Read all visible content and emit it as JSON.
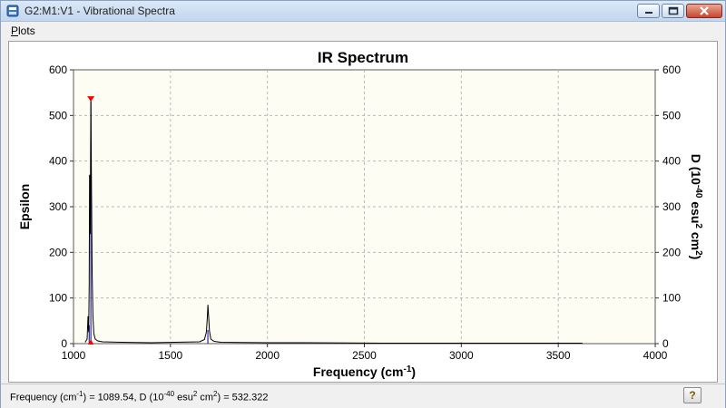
{
  "window": {
    "title": "G2:M1:V1 - Vibrational Spectra",
    "icons": [
      "app-icon",
      "minimize-icon",
      "maximize-icon",
      "close-icon"
    ]
  },
  "menu": {
    "items": [
      {
        "label": "Plots"
      }
    ]
  },
  "status": {
    "prefix": "Frequency (cm",
    "sup1": "-1",
    "mid1": ") = 1089.54, D (10",
    "sup2": "-40",
    "mid2": " esu",
    "sup3": "2",
    "mid3": " cm",
    "sup4": "2",
    "suffix": ") = 532.322",
    "help_icon": "help-icon",
    "help_glyph": "?"
  },
  "colors": {
    "plot_bg": "#fdfdf3",
    "spectrum_line": "#000000",
    "peak_fill": "#2a2aa8",
    "marker": "#ff0000"
  },
  "chart_data": {
    "type": "line",
    "title": "IR Spectrum",
    "xlabel": "Frequency (cm",
    "xlabel_sup": "-1",
    "xlabel_end": ")",
    "ylabel_left": "Epsilon",
    "ylabel_right_parts": [
      "D (10",
      "-40",
      " esu",
      "2",
      " cm",
      "2",
      ")"
    ],
    "xlim": [
      1000,
      4000
    ],
    "ylim": [
      0,
      600
    ],
    "x_ticks": [
      1000,
      1500,
      2000,
      2500,
      3000,
      3500,
      4000
    ],
    "y_ticks": [
      0,
      100,
      200,
      300,
      400,
      500,
      600
    ],
    "grid": true,
    "series": [
      {
        "x": [
          1060,
          1070,
          1075,
          1078,
          1081,
          1083,
          1086,
          1089.54,
          1093,
          1096,
          1100,
          1105,
          1112,
          1125,
          1150,
          1250,
          1400,
          1650,
          1675,
          1685,
          1690,
          1693,
          1697,
          1701,
          1708,
          1725,
          1760,
          2000,
          2200,
          2600,
          3000,
          3300,
          3625
        ],
        "y": [
          3,
          10,
          60,
          25,
          130,
          370,
          240,
          532,
          320,
          160,
          60,
          22,
          10,
          6,
          4,
          3,
          2,
          4,
          9,
          25,
          55,
          85,
          60,
          28,
          10,
          5,
          3,
          2,
          2,
          1,
          1,
          1,
          1
        ]
      }
    ],
    "sticks": [
      {
        "x": 1081,
        "y": 40
      },
      {
        "x": 1089.54,
        "y": 532.322
      },
      {
        "x": 1693,
        "y": 30
      }
    ],
    "marker_x": 1089.54,
    "marker_y": 532.322
  }
}
